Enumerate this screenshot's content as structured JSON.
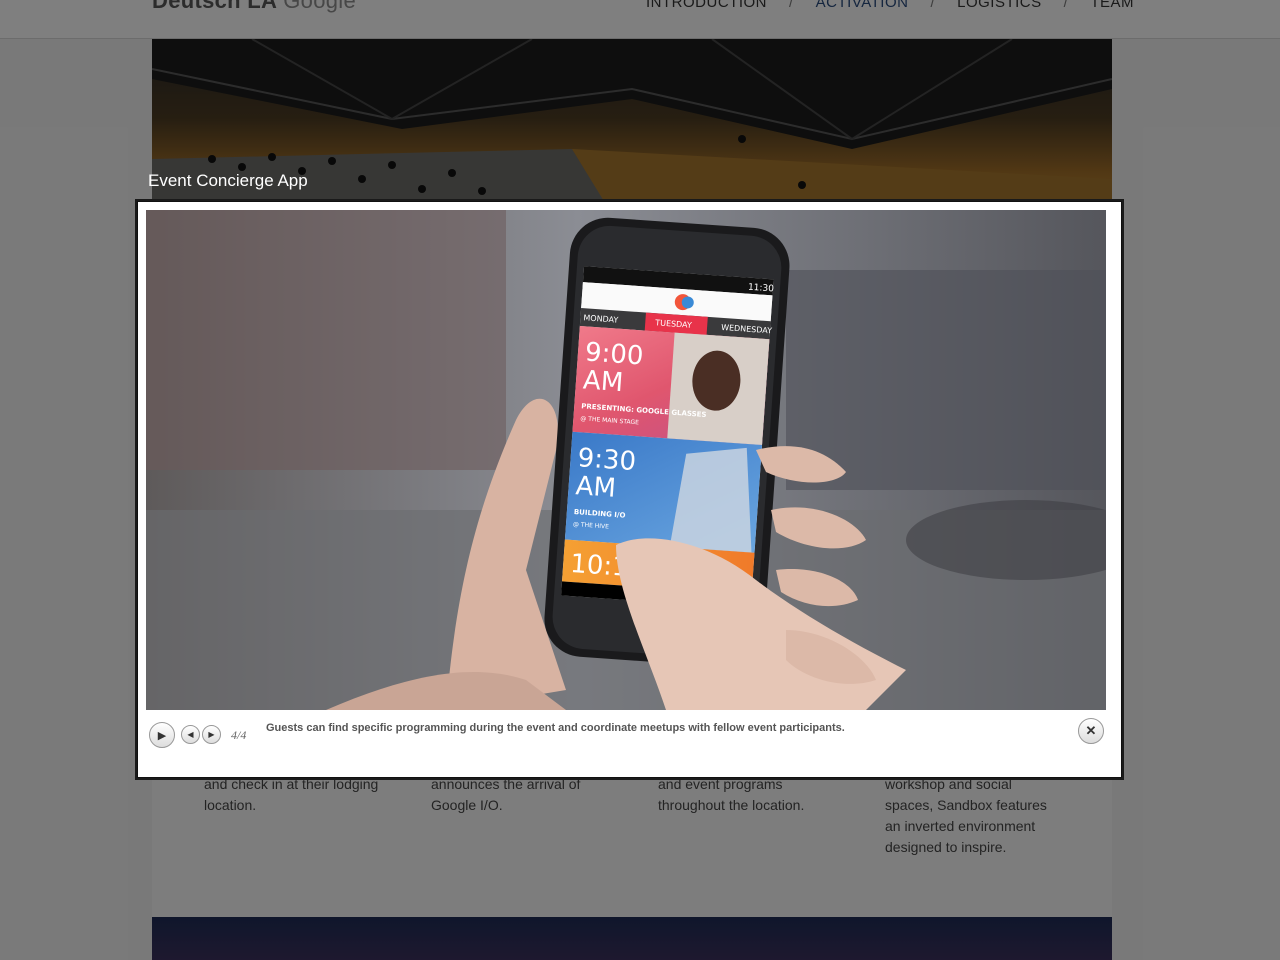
{
  "header": {
    "logo_left": "Deutsch LA",
    "logo_right": "Google",
    "nav": [
      "INTRODUCTION",
      "ACTIVATION",
      "LOGISTICS",
      "TEAM"
    ],
    "nav_separator": "/",
    "active_nav": "ACTIVATION"
  },
  "columns": [
    "and check in at their lodging location.",
    "announces the arrival of Google I/O.",
    "and event programs throughout the location.",
    "workshop and social spaces, Sandbox features an inverted environment designed to inspire."
  ],
  "lightbox": {
    "title": "Event Concierge App",
    "counter": "4/4",
    "caption": "Guests can find specific programming during the event and coordinate meetups with fellow event participants.",
    "controls": {
      "play": "play-icon",
      "prev": "prev-icon",
      "next": "next-icon",
      "close": "close-icon"
    }
  },
  "phone_screen": {
    "status_time": "11:30",
    "app_logo": "I/O",
    "tabs": [
      "MONDAY",
      "TUESDAY",
      "WEDNESDAY"
    ],
    "active_tab": "TUESDAY",
    "events": [
      {
        "time": "9:00",
        "ampm": "AM",
        "title": "PRESENTING: GOOGLE GLASSES",
        "location": "@ THE MAIN STAGE"
      },
      {
        "time": "9:30",
        "ampm": "AM",
        "title": "BUILDING I/O",
        "location": "@ THE HIVE"
      },
      {
        "time": "10:15",
        "ampm": "",
        "title": "",
        "location": ""
      }
    ],
    "accent": "#e8334a"
  }
}
